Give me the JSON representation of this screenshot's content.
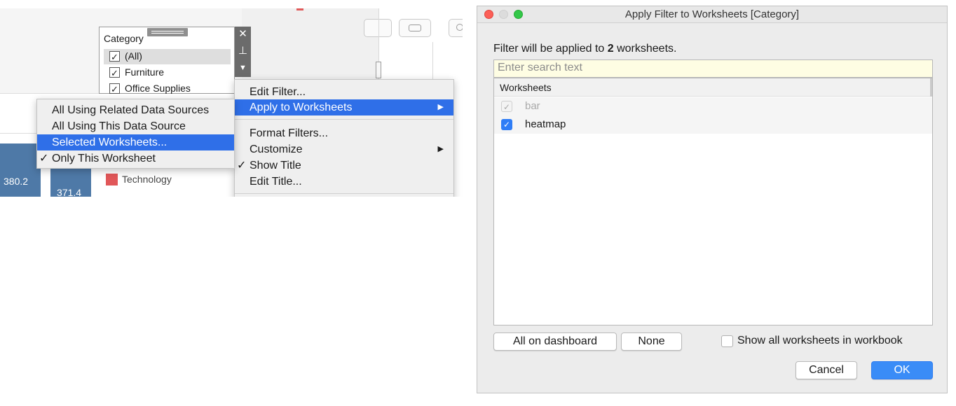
{
  "left": {
    "filter_card": {
      "title": "Category",
      "items": [
        {
          "label": "(All)",
          "checked": true
        },
        {
          "label": "Furniture",
          "checked": true
        },
        {
          "label": "Office Supplies",
          "checked": true
        }
      ]
    },
    "bars": [
      {
        "label": "380.2"
      },
      {
        "label": "371.4"
      }
    ],
    "legend": {
      "label": "Technology",
      "color": "#e15759"
    },
    "main_menu": {
      "items": [
        "Edit Filter...",
        "Apply to Worksheets",
        "Format Filters...",
        "Customize",
        "Show Title",
        "Edit Title..."
      ],
      "highlighted": "Apply to Worksheets",
      "checked": "Show Title"
    },
    "submenu": {
      "items": [
        "All Using Related Data Sources",
        "All Using This Data Source",
        "Selected Worksheets...",
        "Only This Worksheet"
      ],
      "highlighted": "Selected Worksheets...",
      "checked": "Only This Worksheet"
    }
  },
  "dialog": {
    "title": "Apply Filter to Worksheets [Category]",
    "info_prefix": "Filter will be applied to ",
    "info_count": "2",
    "info_suffix": " worksheets.",
    "search_placeholder": "Enter search text",
    "list_header": "Worksheets",
    "worksheets": [
      {
        "name": "bar",
        "checked": true,
        "disabled": true
      },
      {
        "name": "heatmap",
        "checked": true,
        "disabled": false
      }
    ],
    "all_on_dashboard_label": "All on dashboard",
    "none_label": "None",
    "show_all_label": "Show all worksheets in workbook",
    "cancel_label": "Cancel",
    "ok_label": "OK"
  },
  "colors": {
    "accent": "#2f6fe8",
    "bar": "#4e79a7"
  },
  "icons": [
    "close-icon",
    "pin-icon",
    "dropdown-arrow-icon",
    "checkmark-icon",
    "submenu-arrow-icon"
  ]
}
